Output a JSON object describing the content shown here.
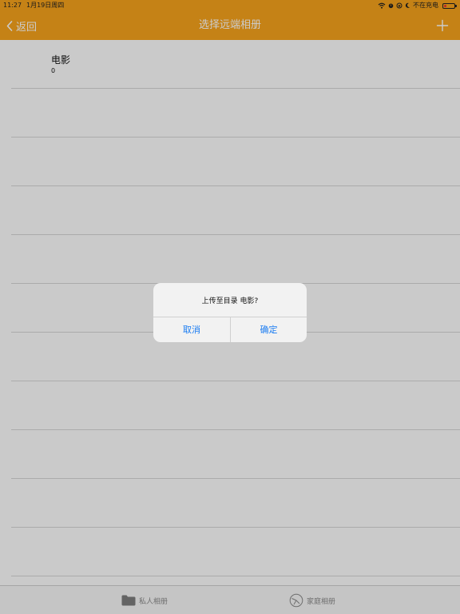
{
  "status_bar": {
    "time": "11:27",
    "date": "1月19日周四",
    "charging_text": "不在充电",
    "icons": [
      "wifi-icon",
      "alarm-icon",
      "lock-rotation-icon",
      "moon-icon",
      "battery-icon"
    ]
  },
  "nav": {
    "back_label": "返回",
    "title": "选择远端相册",
    "add_icon": "plus-icon"
  },
  "albums": [
    {
      "name": "电影",
      "count": "0"
    }
  ],
  "tabbar": {
    "private_label": "私人相册",
    "family_label": "家庭相册"
  },
  "alert": {
    "message": "上传至目录 电影?",
    "cancel_label": "取消",
    "confirm_label": "确定"
  },
  "colors": {
    "accent": "#f7a31c",
    "link": "#1a7cf2",
    "battery_low": "#e33333"
  }
}
